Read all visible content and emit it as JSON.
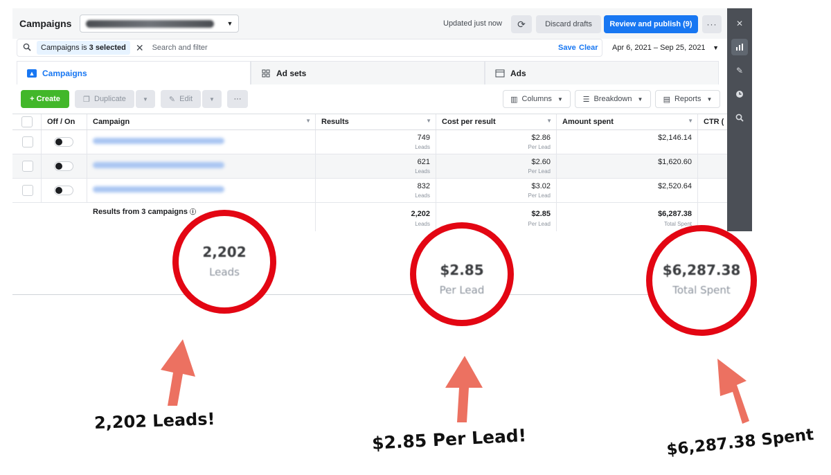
{
  "header": {
    "title": "Campaigns",
    "updated_text": "Updated just now",
    "refresh_icon": "refresh-icon",
    "discard_label": "Discard drafts",
    "publish_label": "Review and publish (9)",
    "more_label": "···"
  },
  "filter": {
    "chip_prefix": "Campaigns is",
    "chip_value": "3 selected",
    "placeholder": "Search and filter",
    "save_label": "Save",
    "clear_label": "Clear",
    "date_range": "Apr 6, 2021 – Sep 25, 2021"
  },
  "tabs": [
    {
      "label": "Campaigns",
      "icon": "campaign-icon"
    },
    {
      "label": "Ad sets",
      "icon": "grid-icon"
    },
    {
      "label": "Ads",
      "icon": "window-icon"
    }
  ],
  "toolbar": {
    "create_label": "+ Create",
    "duplicate_label": "Duplicate",
    "edit_label": "Edit",
    "more_label": "···",
    "columns_label": "Columns",
    "breakdown_label": "Breakdown",
    "reports_label": "Reports"
  },
  "table": {
    "headers": [
      "Off / On",
      "Campaign",
      "Results",
      "Cost per result",
      "Amount spent",
      "CTR ("
    ],
    "rows": [
      {
        "results": "749",
        "results_sub": "Leads",
        "cost": "$2.86",
        "cost_sub": "Per Lead",
        "spent": "$2,146.14"
      },
      {
        "results": "621",
        "results_sub": "Leads",
        "cost": "$2.60",
        "cost_sub": "Per Lead",
        "spent": "$1,620.60"
      },
      {
        "results": "832",
        "results_sub": "Leads",
        "cost": "$3.02",
        "cost_sub": "Per Lead",
        "spent": "$2,520.64"
      }
    ],
    "totals": {
      "label": "Results from 3 campaigns",
      "info_icon": "info-icon",
      "results": "2,202",
      "results_sub": "Leads",
      "cost": "$2.85",
      "cost_sub": "Per Lead",
      "spent": "$6,287.38",
      "spent_sub": "Total Spent"
    }
  },
  "callouts": [
    {
      "value": "2,202",
      "label": "Leads",
      "caption": "2,202 Leads!"
    },
    {
      "value": "$2.85",
      "label": "Per Lead",
      "caption": "$2.85 Per Lead!"
    },
    {
      "value": "$6,287.38",
      "label": "Total Spent",
      "caption": "$6,287.38 Spent"
    }
  ],
  "colors": {
    "highlight_circle": "#e30613",
    "arrow": "#ec7161",
    "primary_blue": "#1877f2",
    "create_green": "#42b72a"
  }
}
